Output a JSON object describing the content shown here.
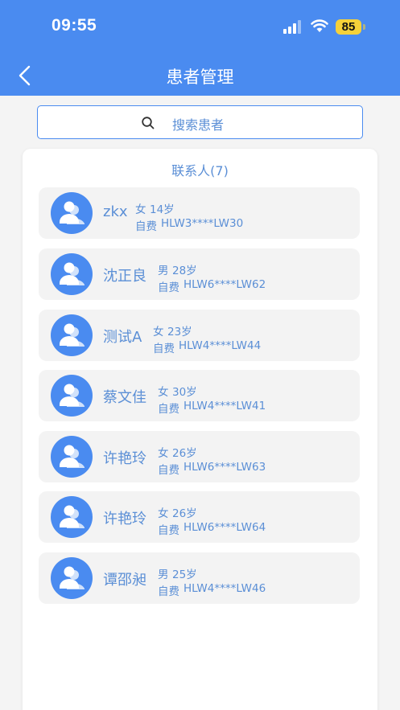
{
  "status_bar": {
    "time": "09:55",
    "battery": "85"
  },
  "nav": {
    "title": "患者管理"
  },
  "search": {
    "placeholder": "搜索患者"
  },
  "contacts": {
    "title": "联系人(7)",
    "items": [
      {
        "name": "zkx",
        "gender": "女",
        "age": "14岁",
        "pay_type": "自费",
        "id": "HLW3****LW30"
      },
      {
        "name": "沈正良",
        "gender": "男",
        "age": "28岁",
        "pay_type": "自费",
        "id": "HLW6****LW62"
      },
      {
        "name": "测试A",
        "gender": "女",
        "age": "23岁",
        "pay_type": "自费",
        "id": "HLW4****LW44"
      },
      {
        "name": "蔡文佳",
        "gender": "女",
        "age": "30岁",
        "pay_type": "自费",
        "id": "HLW4****LW41"
      },
      {
        "name": "许艳玲",
        "gender": "女",
        "age": "26岁",
        "pay_type": "自费",
        "id": "HLW6****LW63"
      },
      {
        "name": "许艳玲",
        "gender": "女",
        "age": "26岁",
        "pay_type": "自费",
        "id": "HLW6****LW64"
      },
      {
        "name": "谭邵昶",
        "gender": "男",
        "age": "25岁",
        "pay_type": "自费",
        "id": "HLW4****LW46"
      }
    ]
  },
  "colors": {
    "primary": "#4a8bf0",
    "text_blue": "#5b8fd6",
    "battery": "#f5d13a"
  },
  "icons": {
    "back": "chevron-left-icon",
    "search": "search-icon",
    "avatar": "user-avatar-icon",
    "signal": "cellular-signal-icon",
    "wifi": "wifi-icon",
    "battery": "battery-icon"
  }
}
